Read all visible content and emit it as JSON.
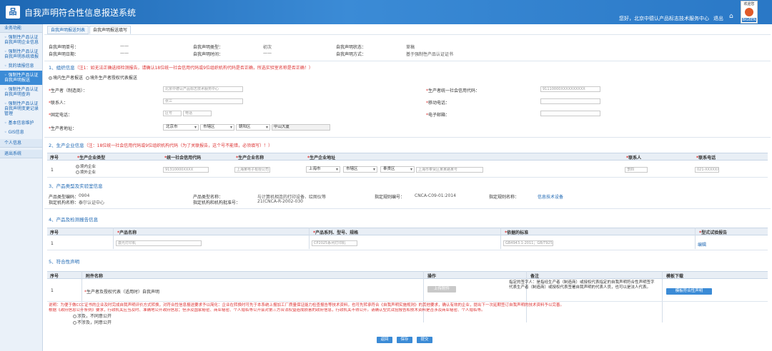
{
  "app": {
    "logo_glyph": "品",
    "title": "自我声明符合性信息报送系统"
  },
  "header": {
    "welcome": "您好，北京中德认产品标志技术服务中心",
    "logout": "退出",
    "home_icon": "⌂",
    "avatar_title": "欢迎您",
    "avatar_tag": "BIGBEN"
  },
  "sidebar": {
    "head": "业务功能",
    "items": [
      {
        "label": "强制性产品认证自我声明企业信息",
        "active": false
      },
      {
        "label": "强制性产品认证自我声明系统填报",
        "active": false
      },
      {
        "label": "我的填报信息",
        "active": false
      },
      {
        "label": "强制性产品认证自我声明报送",
        "active": true
      },
      {
        "label": "强制性产品认证自我声明查询",
        "active": false
      },
      {
        "label": "强制性产品认证自我声明变更记录管理",
        "active": false
      },
      {
        "label": "基本信息维护",
        "active": false
      },
      {
        "label": "GIS信息",
        "active": false
      }
    ],
    "group2": "个人信息",
    "group3": "退出系统"
  },
  "tabs": [
    "自我声明报送列表",
    "自我声明报送填写"
  ],
  "meta": {
    "no_label": "自我声明单号：",
    "no_val": "——",
    "type_label": "自我声明类型：",
    "type_val": "初次",
    "status_label": "自我声明状态：",
    "status_val": "草稿",
    "date_label": "自我声明日期：",
    "date_val": "——",
    "time_label": "自我声明时间：",
    "time_val": "——",
    "method_label": "自我声明方式：",
    "method_val": "基于强制性产品认证证书"
  },
  "sec1": {
    "title": "1、组织信息",
    "note": "（注1：如无法正确选择检测报告，请确认18位统一社会信用代码或9位组织机构代码是否正确，所选实验室名称是否正确！）",
    "radio1": "境内生产者报送",
    "radio2": "境外生产者授权代表报送",
    "producer_label": "生产者（制造商）：",
    "producer_val": "北京中德认产品标志技术服务中心",
    "credit_label": "生产者统一社会信用代码：",
    "credit_val": "91110000XXXXXXXXXX",
    "contact_label": "联系人：",
    "contact_val": "张三",
    "mobile_label": "移动电话：",
    "phone_label": "固定电话：",
    "area_ph": "区号",
    "phone_ph": "电话",
    "email_label": "电子邮箱：",
    "addr_label": "生产者地址：",
    "province": "北京市",
    "city": "市辖区",
    "district": "朝阳区",
    "street": "中山大厦"
  },
  "sec2": {
    "title": "2、生产企业信息",
    "note": "（注：18位统一社会信用代码或9位组织机构代码（为了关联报告，这个号不能错，必须填写）！）",
    "headers": [
      "序号",
      "生产企业类型",
      "统一社会信用代码",
      "生产企业名称",
      "生产企业地址",
      "联系人",
      "联系电话"
    ],
    "row": {
      "no": "1",
      "type1": "境内企业",
      "type2": "境外企业",
      "credit": "91310000XXXX",
      "name": "上海某电子有限公司",
      "province": "上海市",
      "city": "市辖区",
      "district": "奉贤区",
      "street": "上海市奉贤区某某路某号",
      "contact": "李四",
      "phone": "021-XXXXXXX"
    }
  },
  "sec3": {
    "title": "3、产品类型及实验室信息",
    "code_label": "产品类型编码：",
    "code_val": "0904",
    "type_label": "产品类型名称：",
    "type_val": "与计算机相连的打印设备、绘图仪等",
    "rule_label": "指定规则编号：",
    "rule_val": "CNCA-C09-01:2014",
    "rule_name_label": "指定规则名称：",
    "rule_name_val": "信息技术设备",
    "org_label": "指定机构名称：",
    "org_val": "泰尔认证中心",
    "orgno_label": "指定机构和机构批准号：",
    "orgno_val": "21(CNCA-R-2002-030"
  },
  "sec4": {
    "title": "4、产品及检测报告信息",
    "headers": [
      "序号",
      "产品名称",
      "产品系列、型号、规格",
      "依据的标准",
      "型式试验报告"
    ],
    "row": {
      "no": "1",
      "name": "激光打印机",
      "model": "CP2025系列打印机",
      "std": "GB4943.1-2011；GB/T9254-2008",
      "action": "编辑"
    }
  },
  "sec5": {
    "title": "5、符合性声明",
    "headers": [
      "序号",
      "附件名称",
      "操作",
      "备注",
      "模板下载"
    ],
    "row": {
      "no": "1",
      "name": "生产者及授权代表（适用时）自我声明",
      "op": "上传附件",
      "remark": "指定的签字人：是指经生产者（制造商）或授权代表指定的自我声明符合性声明签字代表生产者（制造商）或授权代表签署自我声明的代表人员，也可以是法人代表。",
      "download": "模板符合性声明"
    }
  },
  "footer": {
    "note": "说明：为便于做CCC证书的企业及时完成自我声明评价方式转换，对符合性信息报送要求予以简化：企业在转换时可先于本系统上报加工厂质量保证能力检查报告等技术资料，也可先转承符合《自我声明实施规则》的其他要求，确认有效的企业，提出下一次延期签订自我声明的技术资料予以完善。",
    "note2": "根据《政府信息公开条例》要求，行政机关应当及时、准确地公开政府信息；但涉及国家秘密、商业秘密、个人隐私等公开会对第三方合法权益造成损害的政府信息，行政机关不得公开。请确认型式试验报告和技术资料是否涉及商业秘密、个人隐私等。",
    "opt1": "涉及，不同意公开",
    "opt2": "不涉及，同意公开",
    "btn_back": "返回",
    "btn_save": "保存",
    "btn_submit": "提交"
  }
}
